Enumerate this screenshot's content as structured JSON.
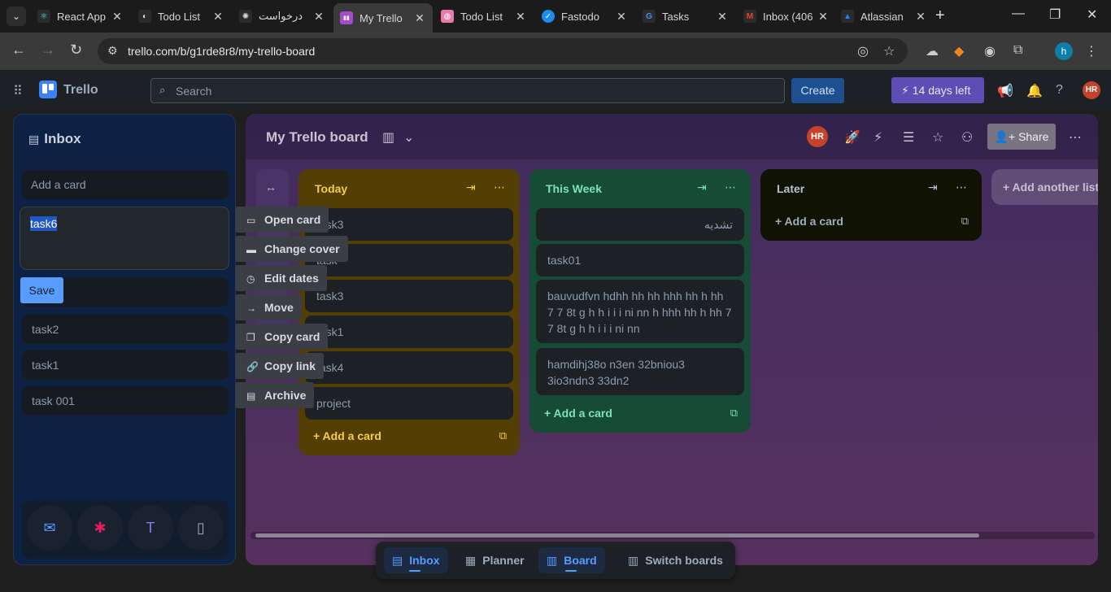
{
  "browser": {
    "tabs": [
      {
        "title": "React App",
        "fav": "⚛",
        "fav_color": "#2b2b2b",
        "fav_fg": "#61dafb"
      },
      {
        "title": "Todo List",
        "fav": "◐",
        "fav_color": "#2b2b2b",
        "fav_fg": "#ddd"
      },
      {
        "title": "درخواست",
        "fav": "✺",
        "fav_color": "#2b2b2b",
        "fav_fg": "#ddd"
      },
      {
        "title": "My Trello",
        "fav": "▮▮",
        "fav_color": "#a64ac9",
        "fav_fg": "#fff"
      },
      {
        "title": "Todo List",
        "fav": "◍",
        "fav_color": "#e879a8",
        "fav_fg": "#fff"
      },
      {
        "title": "Fastodo",
        "fav": "✓",
        "fav_color": "#1d8cf0",
        "fav_fg": "#fff"
      },
      {
        "title": "Tasks",
        "fav": "G",
        "fav_color": "#2b2b2b",
        "fav_fg": "#4a8af4"
      },
      {
        "title": "Inbox (406",
        "fav": "M",
        "fav_color": "#2b2b2b",
        "fav_fg": "#ea4335"
      },
      {
        "title": "Atlassian",
        "fav": "▲",
        "fav_color": "#2b2b2b",
        "fav_fg": "#2684ff"
      }
    ],
    "url": "trello.com/b/g1rde8r8/my-trello-board"
  },
  "header": {
    "app_name": "Trello",
    "search_placeholder": "Search",
    "create_label": "Create",
    "trial_label": "14 days left",
    "avatar_initials": "HR"
  },
  "inbox": {
    "title": "Inbox",
    "add_card_placeholder": "Add a card",
    "editing_text": "task6",
    "save_label": "Save",
    "cards": [
      "task2",
      "task1",
      "task 001"
    ]
  },
  "context_menu": [
    {
      "label": "Open card",
      "icon": "card-icon"
    },
    {
      "label": "Change cover",
      "icon": "cover-icon"
    },
    {
      "label": "Edit dates",
      "icon": "clock-icon"
    },
    {
      "label": "Move",
      "icon": "arrow-right-icon"
    },
    {
      "label": "Copy card",
      "icon": "copy-icon"
    },
    {
      "label": "Copy link",
      "icon": "link-icon"
    },
    {
      "label": "Archive",
      "icon": "archive-icon"
    }
  ],
  "board": {
    "title": "My Trello board",
    "avatar_initials": "HR",
    "share_label": "Share",
    "add_list_label": "Add another list",
    "lists": [
      {
        "title": "Today",
        "color": "#533f04",
        "title_color": "#f5cd47",
        "cards": [
          "task3",
          "task",
          "task3",
          "task1",
          "task4",
          "project"
        ],
        "add_label": "Add a card"
      },
      {
        "title": "This Week",
        "color": "#164b35",
        "title_color": "#7ee2b8",
        "cards": [
          "تشدیه",
          "task01",
          "bauvudfvn hdhh hh hh hhh hh h hh 7 7 8t g h h i i i ni nn h hhh hh h hh 7 7 8t g h h i i i ni nn",
          "hamdihj38o n3en 32bniou3 3io3ndn3 33dn2"
        ],
        "add_label": "Add a card"
      },
      {
        "title": "Later",
        "color": "#101204",
        "title_color": "#b6c2cf",
        "cards": [],
        "add_label": "Add a card"
      }
    ]
  },
  "switcher": {
    "items": [
      {
        "label": "Inbox",
        "active": true
      },
      {
        "label": "Planner",
        "active": false
      },
      {
        "label": "Board",
        "active": true
      },
      {
        "label": "Switch boards",
        "active": false
      }
    ]
  }
}
